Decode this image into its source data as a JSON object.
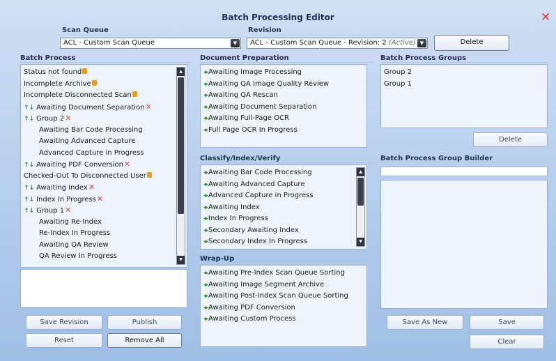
{
  "window": {
    "title": "Batch Processing Editor"
  },
  "header": {
    "scan_queue_label": "Scan Queue",
    "scan_queue_value": "ACL - Custom Scan Queue",
    "revision_label": "Revision",
    "revision_value": "ACL - Custom Scan Queue - Revision: 2",
    "revision_status": "(Active)",
    "delete_label": "Delete"
  },
  "batch_process": {
    "title": "Batch Process",
    "items": [
      {
        "label": "Status not found",
        "marker": "lock",
        "indent": false
      },
      {
        "label": "Incomplete Archive",
        "marker": "lock",
        "indent": false
      },
      {
        "label": "Incomplete Disconnected Scan",
        "marker": "lock",
        "indent": false
      },
      {
        "label": "Awaiting Document Separation",
        "marker": "x",
        "indent": false,
        "arrows": true
      },
      {
        "label": "Group 2",
        "marker": "x",
        "indent": false,
        "arrows": true
      },
      {
        "label": "Awaiting Bar Code Processing",
        "marker": "",
        "indent": true
      },
      {
        "label": "Awaiting Advanced Capture",
        "marker": "",
        "indent": true
      },
      {
        "label": "Advanced Capture in Progress",
        "marker": "",
        "indent": true
      },
      {
        "label": "Awaiting PDF Conversion",
        "marker": "x",
        "indent": false,
        "arrows": true
      },
      {
        "label": "Checked-Out To Disconnected User",
        "marker": "lock",
        "indent": false
      },
      {
        "label": "Awaiting Index",
        "marker": "x",
        "indent": false,
        "arrows": true
      },
      {
        "label": "Index In Progress",
        "marker": "x",
        "indent": false,
        "arrows": true
      },
      {
        "label": "Group 1",
        "marker": "x",
        "indent": false,
        "arrows": true
      },
      {
        "label": "Awaiting Re-Index",
        "marker": "",
        "indent": true
      },
      {
        "label": "Re-Index In Progress",
        "marker": "",
        "indent": true
      },
      {
        "label": "Awaiting QA Review",
        "marker": "",
        "indent": true
      },
      {
        "label": "QA Review In Progress",
        "marker": "",
        "indent": true
      }
    ],
    "save_revision_label": "Save Revision",
    "publish_label": "Publish",
    "reset_label": "Reset",
    "remove_all_label": "Remove All"
  },
  "document_preparation": {
    "title": "Document Preparation",
    "items": [
      "Awaiting Image Processing",
      "Awaiting QA Image Quality Review",
      "Awaiting QA Rescan",
      "Awaiting Document Separation",
      "Awaiting Full-Page OCR",
      "Full Page OCR In Progress"
    ]
  },
  "classify": {
    "title": "Classify/Index/Verify",
    "items": [
      "Awaiting Bar Code Processing",
      "Awaiting Advanced Capture",
      "Advanced Capture in Progress",
      "Awaiting Index",
      "Index In Progress",
      "Secondary Awaiting Index",
      "Secondary Index In Progress"
    ]
  },
  "wrap_up": {
    "title": "Wrap-Up",
    "items": [
      "Awaiting Pre-Index Scan Queue Sorting",
      "Awaiting Image Segment Archive",
      "Awaiting Post-Index Scan Queue Sorting",
      "Awaiting PDF Conversion",
      "Awaiting Custom Process"
    ]
  },
  "groups": {
    "title": "Batch Process Groups",
    "items": [
      "Group 2",
      "Group 1"
    ],
    "delete_label": "Delete"
  },
  "group_builder": {
    "title": "Batch Process Group Builder",
    "name_value": "",
    "save_as_new_label": "Save As New",
    "save_label": "Save",
    "clear_label": "Clear"
  },
  "colors": {
    "accent_red": "#e03c3c",
    "move_green": "#3a8a3a",
    "lock_orange": "#e0a020"
  }
}
